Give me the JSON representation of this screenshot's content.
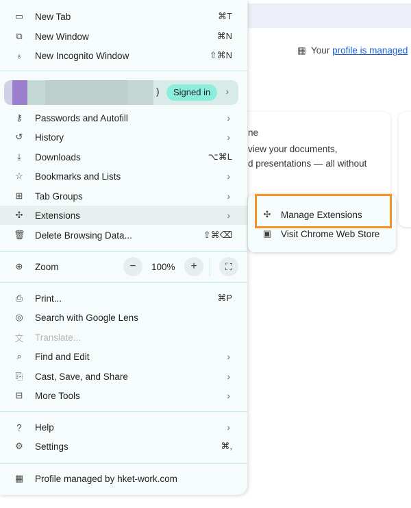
{
  "menu": {
    "group1": [
      {
        "icon": "new-tab-icon",
        "glyph": "▭",
        "label": "New Tab",
        "shortcut": "⌘T"
      },
      {
        "icon": "new-window-icon",
        "glyph": "⧉",
        "label": "New Window",
        "shortcut": "⌘N"
      },
      {
        "icon": "incognito-icon",
        "glyph": "♁",
        "label": "New Incognito Window",
        "shortcut": "⇧⌘N"
      }
    ],
    "profile": {
      "paren": ")",
      "badge": "Signed in"
    },
    "group2": [
      {
        "icon": "key-icon",
        "glyph": "⚷",
        "label": "Passwords and Autofill",
        "chevron": true
      },
      {
        "icon": "history-icon",
        "glyph": "↺",
        "label": "History",
        "chevron": true
      },
      {
        "icon": "download-icon",
        "glyph": "⤓",
        "label": "Downloads",
        "shortcut": "⌥⌘L"
      },
      {
        "icon": "star-icon",
        "glyph": "☆",
        "label": "Bookmarks and Lists",
        "chevron": true
      },
      {
        "icon": "tab-groups-icon",
        "glyph": "⊞",
        "label": "Tab Groups",
        "chevron": true
      },
      {
        "icon": "extension-icon",
        "glyph": "✣",
        "label": "Extensions",
        "chevron": true,
        "highlighted": true
      },
      {
        "icon": "trash-icon",
        "glyph": "🗑",
        "label": "Delete Browsing Data...",
        "shortcut": "⇧⌘⌫"
      }
    ],
    "zoom": {
      "label": "Zoom",
      "value": "100%",
      "minus": "−",
      "plus": "+",
      "fullscreen": "⛶"
    },
    "group3": [
      {
        "icon": "print-icon",
        "glyph": "⎙",
        "label": "Print...",
        "shortcut": "⌘P"
      },
      {
        "icon": "lens-icon",
        "glyph": "◎",
        "label": "Search with Google Lens"
      },
      {
        "icon": "translate-icon",
        "glyph": "文",
        "label": "Translate...",
        "disabled": true
      },
      {
        "icon": "find-icon",
        "glyph": "⌕",
        "label": "Find and Edit",
        "chevron": true
      },
      {
        "icon": "cast-icon",
        "glyph": "⎘",
        "label": "Cast, Save, and Share",
        "chevron": true
      },
      {
        "icon": "toolbox-icon",
        "glyph": "⊟",
        "label": "More Tools",
        "chevron": true
      }
    ],
    "group4": [
      {
        "icon": "help-icon",
        "glyph": "?",
        "label": "Help",
        "chevron": true
      },
      {
        "icon": "settings-icon",
        "glyph": "⚙",
        "label": "Settings",
        "shortcut": "⌘,"
      }
    ],
    "footer": {
      "icon": "building-icon",
      "glyph": "▦",
      "label": "Profile managed by hket-work.com"
    }
  },
  "submenu": [
    {
      "icon": "extension-icon",
      "glyph": "✣",
      "label": "Manage Extensions"
    },
    {
      "icon": "web-store-icon",
      "glyph": "▣",
      "label": "Visit Chrome Web Store"
    }
  ],
  "page": {
    "managed_prefix": "Your ",
    "managed_link": "profile is managed",
    "card_lines": [
      "ne",
      "view your documents,",
      "d presentations — all without"
    ]
  },
  "colors": {
    "highlight_box": "#f39325",
    "signed_in_badge": "#8beedd",
    "separator": "#b8eded"
  }
}
